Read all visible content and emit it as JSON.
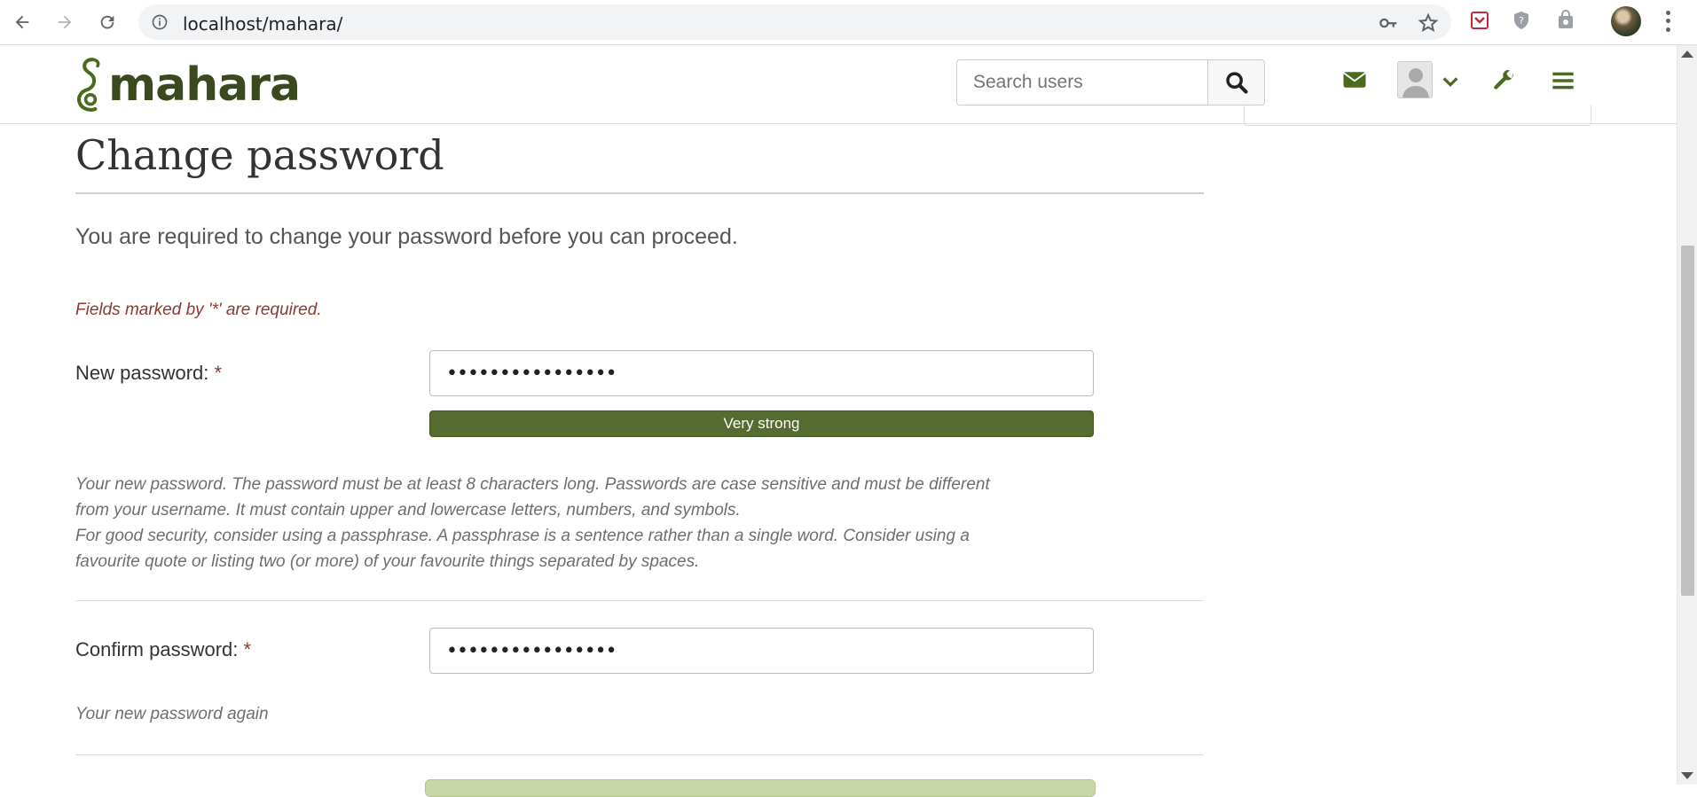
{
  "browser": {
    "url": "localhost/mahara/",
    "icons": [
      "back-arrow-icon",
      "forward-arrow-icon",
      "reload-icon",
      "site-info-icon",
      "password-key-icon",
      "bookmark-star-icon",
      "extension-pocket-icon",
      "extension-shield-icon",
      "extension-shopping-icon",
      "profile-avatar-icon",
      "more-menu-icon"
    ]
  },
  "header": {
    "logo_text": "mahara",
    "search_placeholder": "Search users",
    "icons": [
      "search-icon",
      "mail-icon",
      "user-avatar-icon",
      "chevron-down-icon",
      "wrench-icon",
      "hamburger-menu-icon"
    ]
  },
  "page": {
    "title": "Change password",
    "intro": "You are required to change your password before you can proceed.",
    "required_note": "Fields marked by '*' are required."
  },
  "form": {
    "new_password": {
      "label": "New password:",
      "required_marker": "*",
      "value": "••••••••••••••••",
      "strength": "Very strong",
      "help_line1": "Your new password. The password must be at least 8 characters long. Passwords are case sensitive and must be different from your username. It must contain upper and lowercase letters, numbers, and symbols.",
      "help_line2": "For good security, consider using a passphrase. A passphrase is a sentence rather than a single word. Consider using a favourite quote or listing two (or more) of your favourite things separated by spaces."
    },
    "confirm_password": {
      "label": "Confirm password:",
      "required_marker": "*",
      "value": "••••••••••••••••",
      "help": "Your new password again"
    }
  },
  "colors": {
    "brand_green": "#556b2f",
    "required_red": "#8a3a2e",
    "icon_green": "#4a6a1e"
  }
}
